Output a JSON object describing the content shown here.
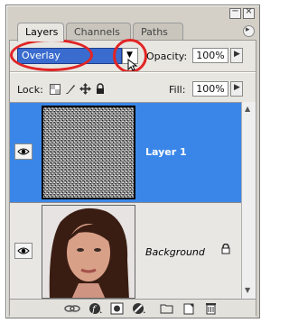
{
  "panel": {
    "tabs": [
      {
        "label": "Layers"
      },
      {
        "label": "Channels"
      },
      {
        "label": "Paths"
      }
    ],
    "window_buttons": {
      "minimize": "−",
      "close": "×"
    },
    "menu_glyph": "▸"
  },
  "blend": {
    "mode": "Overlay",
    "opacity_label": "Opacity:",
    "opacity_value": "100%",
    "fill_label": "Fill:",
    "fill_value": "100%"
  },
  "lock": {
    "label": "Lock:"
  },
  "layers": [
    {
      "name": "Layer 1",
      "selected": true,
      "visible": true,
      "icon": "noise-thumbnail"
    },
    {
      "name": "Background",
      "selected": false,
      "visible": true,
      "locked": true,
      "icon": "portrait-thumbnail"
    }
  ],
  "bottom_icons": [
    "link-layers-icon",
    "layer-style-icon",
    "layer-mask-icon",
    "adjustment-layer-icon",
    "new-group-icon",
    "new-layer-icon",
    "delete-layer-icon"
  ],
  "colors": {
    "selection": "#3a86e8",
    "annotation": "#e12424",
    "blend_field": "#3a6ccf"
  }
}
